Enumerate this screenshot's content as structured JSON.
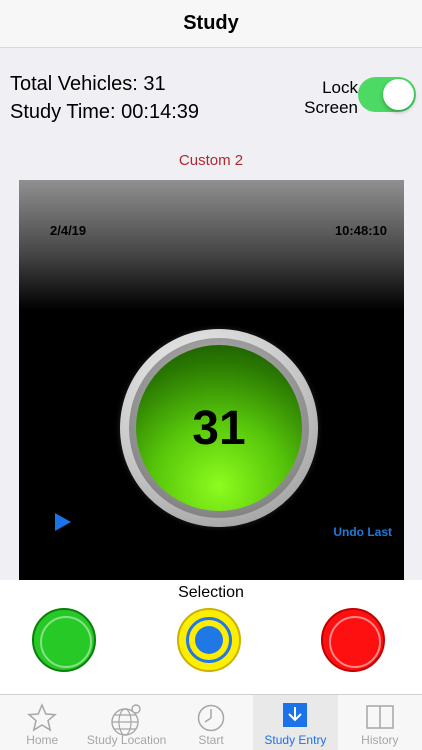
{
  "nav": {
    "title": "Study"
  },
  "stats": {
    "total_vehicles": "Total Vehicles: 31",
    "study_time": "Study Time: 00:14:39"
  },
  "lock": {
    "label_line1": "Lock",
    "label_line2": "Screen",
    "on": true
  },
  "custom_label": "Custom 2",
  "panel": {
    "date": "2/4/19",
    "time": "10:48:10",
    "count": "31",
    "undo_label": "Undo Last"
  },
  "selection": {
    "label": "Selection",
    "options": [
      "green",
      "yellow-target",
      "red"
    ]
  },
  "tabs": [
    {
      "label": "Home",
      "icon": "star-icon"
    },
    {
      "label": "Study Location",
      "icon": "globe-pin-icon"
    },
    {
      "label": "Start",
      "icon": "clock-icon"
    },
    {
      "label": "Study Entry",
      "icon": "download-icon",
      "active": true
    },
    {
      "label": "History",
      "icon": "book-icon"
    }
  ],
  "colors": {
    "accent": "#1a73e8",
    "custom_text": "#b0282e",
    "toggle_on": "#4cd964"
  }
}
